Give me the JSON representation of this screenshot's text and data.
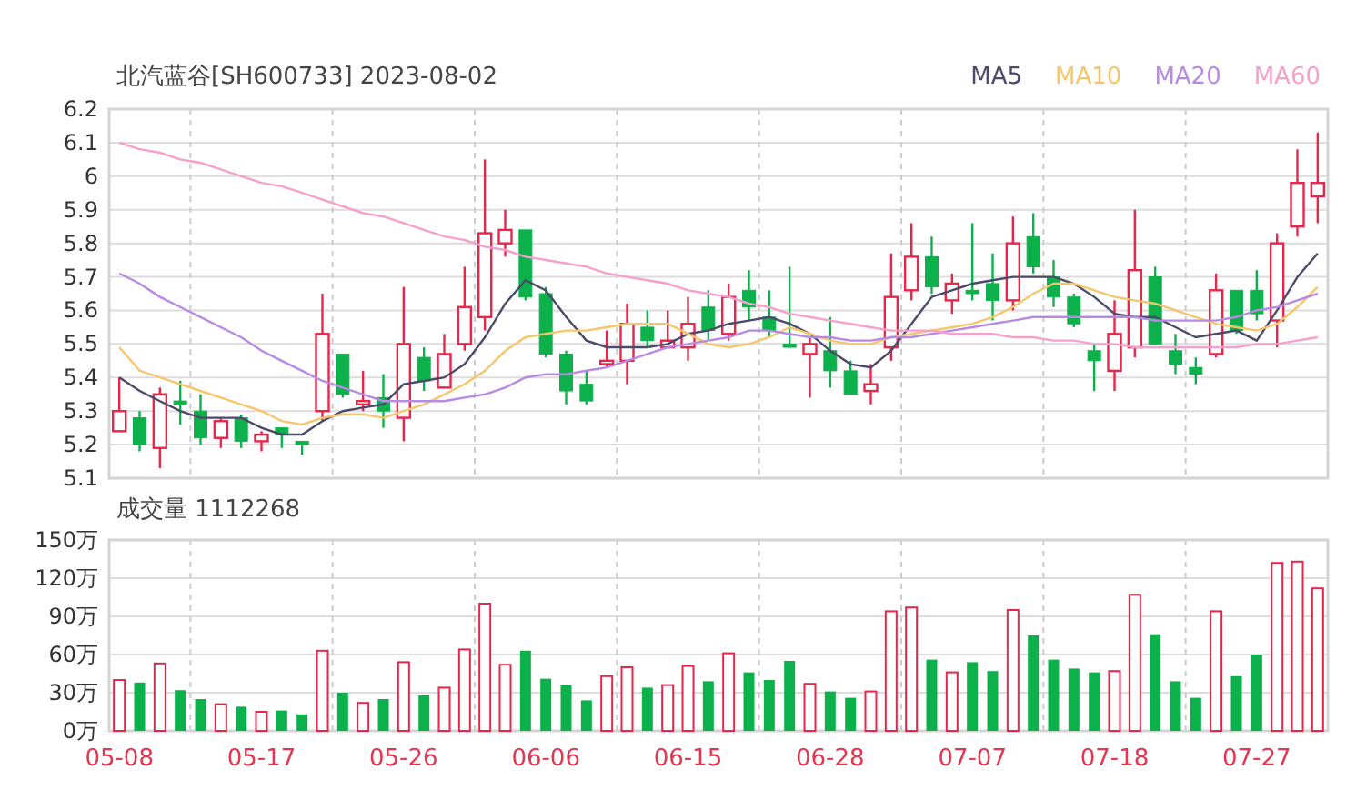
{
  "price_chart": {
    "chart_data": {
      "type": "candlestick",
      "title": "北汽蓝谷[SH600733] 2023-08-02",
      "grid": true,
      "ylim": [
        5.1,
        6.2
      ],
      "yticks": [
        6.2,
        6.1,
        6.0,
        5.9,
        5.8,
        5.7,
        5.6,
        5.5,
        5.4,
        5.3,
        5.2,
        5.1
      ],
      "categories": [
        null,
        null,
        null,
        null,
        null,
        null,
        null,
        null,
        null,
        null,
        null,
        null,
        null,
        null,
        null,
        null,
        null,
        null,
        null,
        null,
        null,
        null,
        null,
        null,
        null,
        null,
        null,
        null,
        null,
        null,
        null,
        null,
        null,
        null,
        null,
        null,
        null,
        null,
        null,
        null,
        null,
        null,
        null,
        null,
        null,
        null,
        null,
        null,
        null,
        null,
        null,
        null,
        null,
        null,
        null,
        null,
        null,
        null,
        null,
        null
      ],
      "ohlc": [
        [
          5.24,
          5.4,
          5.24,
          5.3
        ],
        [
          5.28,
          5.3,
          5.18,
          5.2
        ],
        [
          5.19,
          5.37,
          5.13,
          5.35
        ],
        [
          5.33,
          5.39,
          5.26,
          5.32
        ],
        [
          5.3,
          5.35,
          5.2,
          5.22
        ],
        [
          5.22,
          5.28,
          5.19,
          5.27
        ],
        [
          5.28,
          5.29,
          5.19,
          5.21
        ],
        [
          5.21,
          5.24,
          5.18,
          5.23
        ],
        [
          5.25,
          5.25,
          5.19,
          5.23
        ],
        [
          5.21,
          5.21,
          5.17,
          5.2
        ],
        [
          5.3,
          5.65,
          5.27,
          5.53
        ],
        [
          5.47,
          5.47,
          5.34,
          5.35
        ],
        [
          5.32,
          5.42,
          5.3,
          5.33
        ],
        [
          5.34,
          5.41,
          5.25,
          5.3
        ],
        [
          5.28,
          5.67,
          5.21,
          5.5
        ],
        [
          5.46,
          5.49,
          5.36,
          5.39
        ],
        [
          5.37,
          5.53,
          5.37,
          5.47
        ],
        [
          5.5,
          5.73,
          5.48,
          5.61
        ],
        [
          5.58,
          6.05,
          5.54,
          5.83
        ],
        [
          5.8,
          5.9,
          5.76,
          5.84
        ],
        [
          5.84,
          5.84,
          5.63,
          5.64
        ],
        [
          5.65,
          5.67,
          5.46,
          5.47
        ],
        [
          5.47,
          5.48,
          5.32,
          5.36
        ],
        [
          5.38,
          5.42,
          5.32,
          5.33
        ],
        [
          5.44,
          5.54,
          5.43,
          5.45
        ],
        [
          5.45,
          5.62,
          5.38,
          5.56
        ],
        [
          5.55,
          5.6,
          5.49,
          5.51
        ],
        [
          5.49,
          5.6,
          5.49,
          5.51
        ],
        [
          5.49,
          5.64,
          5.45,
          5.56
        ],
        [
          5.61,
          5.66,
          5.51,
          5.54
        ],
        [
          5.53,
          5.68,
          5.51,
          5.64
        ],
        [
          5.66,
          5.72,
          5.57,
          5.61
        ],
        [
          5.58,
          5.66,
          5.52,
          5.54
        ],
        [
          5.5,
          5.73,
          5.49,
          5.49
        ],
        [
          5.47,
          5.52,
          5.34,
          5.5
        ],
        [
          5.48,
          5.58,
          5.37,
          5.42
        ],
        [
          5.42,
          5.45,
          5.35,
          5.35
        ],
        [
          5.36,
          5.44,
          5.32,
          5.38
        ],
        [
          5.49,
          5.77,
          5.45,
          5.64
        ],
        [
          5.66,
          5.86,
          5.63,
          5.76
        ],
        [
          5.76,
          5.82,
          5.65,
          5.67
        ],
        [
          5.63,
          5.71,
          5.59,
          5.68
        ],
        [
          5.66,
          5.86,
          5.63,
          5.65
        ],
        [
          5.68,
          5.77,
          5.57,
          5.63
        ],
        [
          5.63,
          5.88,
          5.6,
          5.8
        ],
        [
          5.82,
          5.89,
          5.71,
          5.73
        ],
        [
          5.7,
          5.75,
          5.61,
          5.64
        ],
        [
          5.64,
          5.65,
          5.55,
          5.56
        ],
        [
          5.48,
          5.5,
          5.36,
          5.45
        ],
        [
          5.42,
          5.63,
          5.36,
          5.53
        ],
        [
          5.49,
          5.9,
          5.46,
          5.72
        ],
        [
          5.7,
          5.73,
          5.5,
          5.5
        ],
        [
          5.48,
          5.53,
          5.41,
          5.44
        ],
        [
          5.43,
          5.46,
          5.38,
          5.41
        ],
        [
          5.47,
          5.71,
          5.46,
          5.66
        ],
        [
          5.66,
          5.66,
          5.53,
          5.54
        ],
        [
          5.66,
          5.72,
          5.57,
          5.59
        ],
        [
          5.57,
          5.83,
          5.49,
          5.8
        ],
        [
          5.85,
          6.08,
          5.82,
          5.98
        ],
        [
          5.94,
          6.13,
          5.86,
          5.98
        ]
      ],
      "series": [
        {
          "name": "MA5",
          "type": "line",
          "color": "#4b4a6b",
          "values": [
            5.4,
            5.36,
            5.33,
            5.3,
            5.28,
            5.28,
            5.28,
            5.25,
            5.23,
            5.23,
            5.27,
            5.3,
            5.31,
            5.32,
            5.38,
            5.39,
            5.4,
            5.44,
            5.52,
            5.62,
            5.69,
            5.66,
            5.58,
            5.51,
            5.49,
            5.49,
            5.49,
            5.5,
            5.53,
            5.54,
            5.56,
            5.57,
            5.58,
            5.56,
            5.53,
            5.48,
            5.44,
            5.43,
            5.48,
            5.56,
            5.64,
            5.66,
            5.68,
            5.69,
            5.7,
            5.7,
            5.7,
            5.68,
            5.64,
            5.59,
            5.58,
            5.58,
            5.55,
            5.52,
            5.53,
            5.54,
            5.51,
            5.6,
            5.7,
            5.77
          ]
        },
        {
          "name": "MA10",
          "type": "line",
          "color": "#f7c66b",
          "values": [
            5.49,
            5.42,
            5.4,
            5.38,
            5.36,
            5.34,
            5.32,
            5.3,
            5.27,
            5.26,
            5.28,
            5.29,
            5.29,
            5.28,
            5.3,
            5.32,
            5.35,
            5.38,
            5.42,
            5.48,
            5.52,
            5.53,
            5.54,
            5.54,
            5.55,
            5.56,
            5.56,
            5.56,
            5.53,
            5.5,
            5.49,
            5.5,
            5.52,
            5.55,
            5.53,
            5.51,
            5.5,
            5.5,
            5.52,
            5.53,
            5.54,
            5.55,
            5.56,
            5.58,
            5.61,
            5.65,
            5.68,
            5.68,
            5.66,
            5.64,
            5.63,
            5.62,
            5.6,
            5.58,
            5.56,
            5.55,
            5.54,
            5.56,
            5.61,
            5.67
          ]
        },
        {
          "name": "MA20",
          "type": "line",
          "color": "#b98ae3",
          "values": [
            5.71,
            5.68,
            5.64,
            5.61,
            5.58,
            5.55,
            5.52,
            5.48,
            5.45,
            5.42,
            5.39,
            5.37,
            5.35,
            5.33,
            5.33,
            5.33,
            5.33,
            5.34,
            5.35,
            5.37,
            5.4,
            5.41,
            5.41,
            5.42,
            5.43,
            5.45,
            5.47,
            5.49,
            5.5,
            5.51,
            5.52,
            5.54,
            5.54,
            5.53,
            5.52,
            5.52,
            5.51,
            5.51,
            5.52,
            5.52,
            5.53,
            5.54,
            5.55,
            5.56,
            5.57,
            5.58,
            5.58,
            5.58,
            5.58,
            5.58,
            5.58,
            5.57,
            5.57,
            5.57,
            5.57,
            5.58,
            5.6,
            5.61,
            5.63,
            5.65
          ]
        },
        {
          "name": "MA60",
          "type": "line",
          "color": "#f6a0cb",
          "values": [
            6.1,
            6.08,
            6.07,
            6.05,
            6.04,
            6.02,
            6.0,
            5.98,
            5.97,
            5.95,
            5.93,
            5.91,
            5.89,
            5.88,
            5.86,
            5.84,
            5.82,
            5.81,
            5.79,
            5.78,
            5.76,
            5.75,
            5.74,
            5.73,
            5.71,
            5.7,
            5.69,
            5.68,
            5.66,
            5.65,
            5.64,
            5.62,
            5.61,
            5.59,
            5.58,
            5.57,
            5.56,
            5.55,
            5.54,
            5.54,
            5.54,
            5.53,
            5.53,
            5.53,
            5.52,
            5.52,
            5.51,
            5.51,
            5.5,
            5.5,
            5.49,
            5.49,
            5.49,
            5.49,
            5.49,
            5.49,
            5.5,
            5.5,
            5.51,
            5.52
          ]
        }
      ]
    }
  },
  "volume_chart": {
    "chart_data": {
      "type": "bar",
      "title": "成交量 1112268",
      "grid": true,
      "ylim": [
        0,
        150
      ],
      "yticks": [
        {
          "value": 150,
          "label": "150万"
        },
        {
          "value": 120,
          "label": "120万"
        },
        {
          "value": 90,
          "label": "90万"
        },
        {
          "value": 60,
          "label": "60万"
        },
        {
          "value": 30,
          "label": "30万"
        },
        {
          "value": 0,
          "label": "0万"
        }
      ],
      "categories": [
        "05-08",
        null,
        null,
        null,
        null,
        null,
        null,
        "05-17",
        null,
        null,
        null,
        null,
        null,
        null,
        "05-26",
        null,
        null,
        null,
        null,
        null,
        null,
        "06-06",
        null,
        null,
        null,
        null,
        null,
        null,
        "06-15",
        null,
        null,
        null,
        null,
        null,
        null,
        "06-28",
        null,
        null,
        null,
        null,
        null,
        null,
        "07-07",
        null,
        null,
        null,
        null,
        null,
        null,
        "07-18",
        null,
        null,
        null,
        null,
        null,
        null,
        "07-27",
        null,
        null,
        null
      ],
      "values": [
        40,
        38,
        53,
        32,
        25,
        21,
        19,
        15,
        16,
        13,
        63,
        30,
        22,
        25,
        54,
        28,
        34,
        64,
        100,
        52,
        63,
        41,
        36,
        24,
        43,
        50,
        34,
        36,
        51,
        39,
        61,
        46,
        40,
        55,
        37,
        31,
        26,
        31,
        94,
        97,
        56,
        46,
        54,
        47,
        95,
        75,
        56,
        49,
        46,
        47,
        107,
        76,
        39,
        26,
        94,
        43,
        60,
        132,
        133,
        112
      ]
    }
  }
}
